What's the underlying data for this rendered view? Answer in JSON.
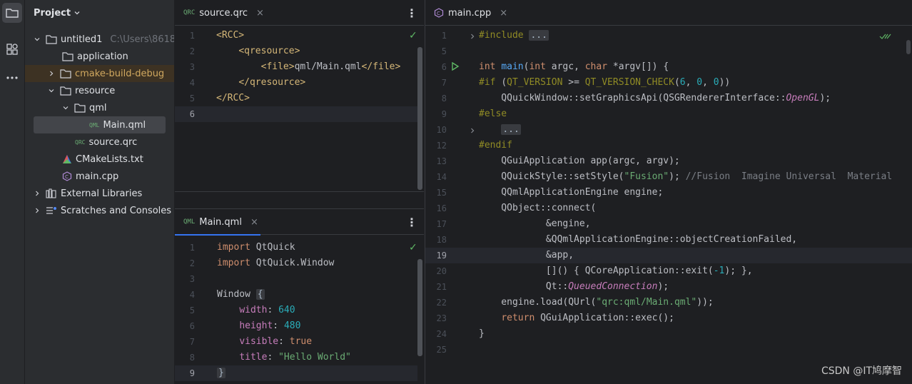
{
  "activity_bar": {
    "icons": [
      "folder-icon",
      "structure-icon",
      "more-icon"
    ]
  },
  "project_panel": {
    "title": "Project",
    "tree": [
      {
        "label": "untitled1",
        "hint": "C:\\Users\\8618(",
        "icon": "folder-icon",
        "expanded": true
      },
      {
        "label": "application",
        "icon": "folder-icon"
      },
      {
        "label": "cmake-build-debug",
        "icon": "folder-icon",
        "expanded": false
      },
      {
        "label": "resource",
        "icon": "folder-icon",
        "expanded": true
      },
      {
        "label": "qml",
        "icon": "folder-icon",
        "expanded": true
      },
      {
        "label": "Main.qml",
        "icon": "qml-file-icon",
        "badge": "QML"
      },
      {
        "label": "source.qrc",
        "icon": "qrc-file-icon",
        "badge": "QRC"
      },
      {
        "label": "CMakeLists.txt",
        "icon": "cmake-icon"
      },
      {
        "label": "main.cpp",
        "icon": "cpp-file-icon"
      },
      {
        "label": "External Libraries",
        "icon": "library-icon",
        "expanded": false
      },
      {
        "label": "Scratches and Consoles",
        "icon": "scratches-icon",
        "expanded": false
      }
    ]
  },
  "editor_qrc": {
    "tab": {
      "label": "source.qrc",
      "badge": "QRC",
      "close": "×"
    },
    "more": "⋮",
    "line_numbers": [
      "1",
      "2",
      "3",
      "4",
      "5",
      "6"
    ],
    "current_line": "6",
    "lines": [
      [
        {
          "t": "<RCC>",
          "c": "tag"
        }
      ],
      [
        {
          "t": "    "
        },
        {
          "t": "<qresource>",
          "c": "tag"
        }
      ],
      [
        {
          "t": "        "
        },
        {
          "t": "<file>",
          "c": "tag"
        },
        {
          "t": "qml/Main.qml"
        },
        {
          "t": "</file>",
          "c": "tag"
        }
      ],
      [
        {
          "t": "    "
        },
        {
          "t": "</qresource>",
          "c": "tag"
        }
      ],
      [
        {
          "t": "</RCC>",
          "c": "tag"
        }
      ],
      []
    ]
  },
  "editor_qml": {
    "tab": {
      "label": "Main.qml",
      "badge": "QML",
      "close": "×"
    },
    "more": "⋮",
    "line_numbers": [
      "1",
      "2",
      "3",
      "4",
      "5",
      "6",
      "7",
      "8",
      "9"
    ],
    "current_line": "9",
    "lines": [
      [
        {
          "t": "import",
          "c": "kw"
        },
        {
          "t": " QtQuick"
        }
      ],
      [
        {
          "t": "import",
          "c": "kw"
        },
        {
          "t": " QtQuick.Window"
        }
      ],
      [],
      [
        {
          "t": "Window "
        },
        {
          "t": "{",
          "c": "fold"
        }
      ],
      [
        {
          "t": "    "
        },
        {
          "t": "width",
          "c": "prop"
        },
        {
          "t": ": "
        },
        {
          "t": "640",
          "c": "num"
        }
      ],
      [
        {
          "t": "    "
        },
        {
          "t": "height",
          "c": "prop"
        },
        {
          "t": ": "
        },
        {
          "t": "480",
          "c": "num"
        }
      ],
      [
        {
          "t": "    "
        },
        {
          "t": "visible",
          "c": "prop"
        },
        {
          "t": ": "
        },
        {
          "t": "true",
          "c": "kw"
        }
      ],
      [
        {
          "t": "    "
        },
        {
          "t": "title",
          "c": "prop"
        },
        {
          "t": ": "
        },
        {
          "t": "\"Hello World\"",
          "c": "str"
        }
      ],
      [
        {
          "t": "}",
          "c": "fold"
        }
      ]
    ]
  },
  "editor_cpp": {
    "tab": {
      "label": "main.cpp",
      "close": "×"
    },
    "line_numbers": [
      "1",
      "5",
      "6",
      "7",
      "8",
      "9",
      "10",
      "12",
      "13",
      "14",
      "15",
      "16",
      "17",
      "18",
      "19",
      "20",
      "21",
      "22",
      "23",
      "24",
      "25"
    ],
    "current_line": "19",
    "lines": [
      [
        {
          "t": "#include ",
          "c": "macro"
        },
        {
          "t": "...",
          "c": "fold"
        }
      ],
      [],
      [
        {
          "t": "int ",
          "c": "kw"
        },
        {
          "t": "main",
          "c": "fn"
        },
        {
          "t": "("
        },
        {
          "t": "int ",
          "c": "kw"
        },
        {
          "t": "argc, "
        },
        {
          "t": "char ",
          "c": "kw"
        },
        {
          "t": "*argv[]) {"
        }
      ],
      [
        {
          "t": "#if ",
          "c": "macro"
        },
        {
          "t": "("
        },
        {
          "t": "QT_VERSION",
          "c": "macro"
        },
        {
          "t": " >= "
        },
        {
          "t": "QT_VERSION_CHECK",
          "c": "macro"
        },
        {
          "t": "("
        },
        {
          "t": "6",
          "c": "num"
        },
        {
          "t": ", "
        },
        {
          "t": "0",
          "c": "num"
        },
        {
          "t": ", "
        },
        {
          "t": "0",
          "c": "num"
        },
        {
          "t": "))"
        }
      ],
      [
        {
          "t": "    QQuickWindow::setGraphicsApi(QSGRendererInterface::"
        },
        {
          "t": "OpenGL",
          "c": "it"
        },
        {
          "t": ");"
        }
      ],
      [
        {
          "t": "#else",
          "c": "macro"
        }
      ],
      [
        {
          "t": "    "
        },
        {
          "t": "...",
          "c": "fold"
        }
      ],
      [
        {
          "t": "#endif",
          "c": "macro"
        }
      ],
      [
        {
          "t": "    QGuiApplication app(argc, argv);"
        }
      ],
      [
        {
          "t": "    QQuickStyle::setStyle("
        },
        {
          "t": "\"Fusion\"",
          "c": "str"
        },
        {
          "t": "); "
        },
        {
          "t": "//Fusion  Imagine Universal  Material",
          "c": "cm"
        }
      ],
      [
        {
          "t": "    QQmlApplicationEngine engine;"
        }
      ],
      [
        {
          "t": "    QObject::connect("
        }
      ],
      [
        {
          "t": "            &engine,"
        }
      ],
      [
        {
          "t": "            &QQmlApplicationEngine::objectCreationFailed,"
        }
      ],
      [
        {
          "t": "            &app,"
        }
      ],
      [
        {
          "t": "            []() { QCoreApplication::exit("
        },
        {
          "t": "-1",
          "c": "num"
        },
        {
          "t": "); },"
        }
      ],
      [
        {
          "t": "            Qt::"
        },
        {
          "t": "QueuedConnection",
          "c": "it"
        },
        {
          "t": ");"
        }
      ],
      [
        {
          "t": "    engine.load(QUrl("
        },
        {
          "t": "\"qrc:qml/Main.qml\"",
          "c": "str"
        },
        {
          "t": "));"
        }
      ],
      [
        {
          "t": "    "
        },
        {
          "t": "return ",
          "c": "kw"
        },
        {
          "t": "QGuiApplication::exec();"
        }
      ],
      [
        {
          "t": "}"
        }
      ],
      []
    ]
  },
  "watermark": "CSDN @IT鸠摩智",
  "colors": {
    "background": "#1e1f22",
    "panel": "#2b2d30",
    "accent": "#3574f0",
    "keyword": "#cf8e6d",
    "string": "#6aab73",
    "number": "#2aacb8",
    "function": "#56a8f5",
    "tag": "#d5b778",
    "check": "#5fb865"
  }
}
